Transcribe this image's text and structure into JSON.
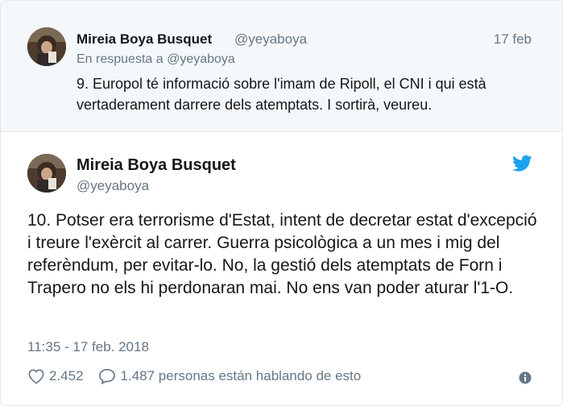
{
  "parent_tweet": {
    "author_name": "Mireia Boya Busquet",
    "author_handle": "@yeyaboya",
    "date": "17 feb",
    "reply_prefix": "En respuesta a",
    "reply_handle": "@yeyaboya",
    "text": "9. Europol té informació sobre l'imam de Ripoll, el CNI i qui està vertaderament darrere dels atemptats. I sortirà, veureu."
  },
  "main_tweet": {
    "author_name": "Mireia Boya Busquet",
    "author_handle": "@yeyaboya",
    "text": "10. Potser era terrorisme d'Estat, intent de decretar estat d'excepció i treure l'exèrcit al carrer. Guerra psicològica a un mes i mig del referèndum, per evitar-lo. No, la gestió dels atemptats de Forn i Trapero no els hi perdonaran mai. No ens van poder aturar l'1-O.",
    "timestamp": "11:35 - 17 feb. 2018",
    "likes": "2.452",
    "replies_text": "1.487 personas están hablando de esto"
  },
  "icons": {
    "avatar": "avatar-photo",
    "brand": "twitter-bird-icon",
    "like": "heart-icon",
    "reply": "comment-bubble-icon",
    "info": "info-icon"
  },
  "colors": {
    "brand_blue": "#1da1f2",
    "secondary_text": "#657786",
    "parent_background": "#f5f8fa",
    "border": "#e1e8ed"
  }
}
